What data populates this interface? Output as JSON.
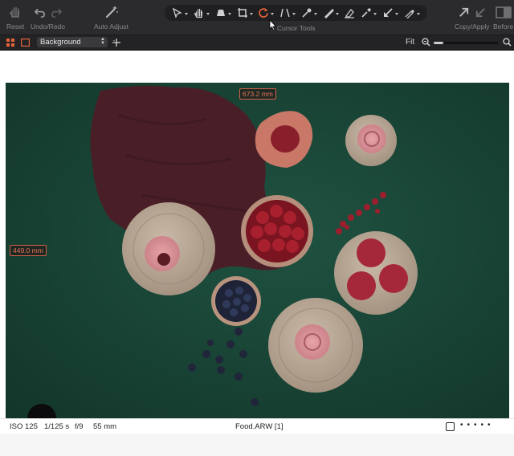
{
  "toolbar": {
    "reset_label": "Reset",
    "undo_redo_label": "Undo/Redo",
    "auto_adjust_label": "Auto Adjust",
    "cursor_tools_label": "Cursor Tools",
    "copy_apply_label": "Copy/Apply",
    "before_label": "Before",
    "cursor_tools": [
      "select-arrow-icon",
      "hand-pan-icon",
      "straighten-icon",
      "crop-icon",
      "rotate-icon",
      "keystone-icon",
      "color-picker-icon",
      "brush-icon",
      "eraser-icon",
      "gradient-icon",
      "arrow-pick-icon",
      "fill-icon"
    ],
    "accent": "#e8623a"
  },
  "subbar": {
    "layer_name": "Background",
    "fit_label": "Fit",
    "zoom_fraction": 0.15
  },
  "viewer": {
    "measure_width": "673.2 mm",
    "measure_height": "449.0 mm"
  },
  "status": {
    "iso": "ISO 125",
    "shutter": "1/125 s",
    "aperture": "f/9",
    "focal": "55 mm",
    "filename": "Food.ARW [1]"
  }
}
